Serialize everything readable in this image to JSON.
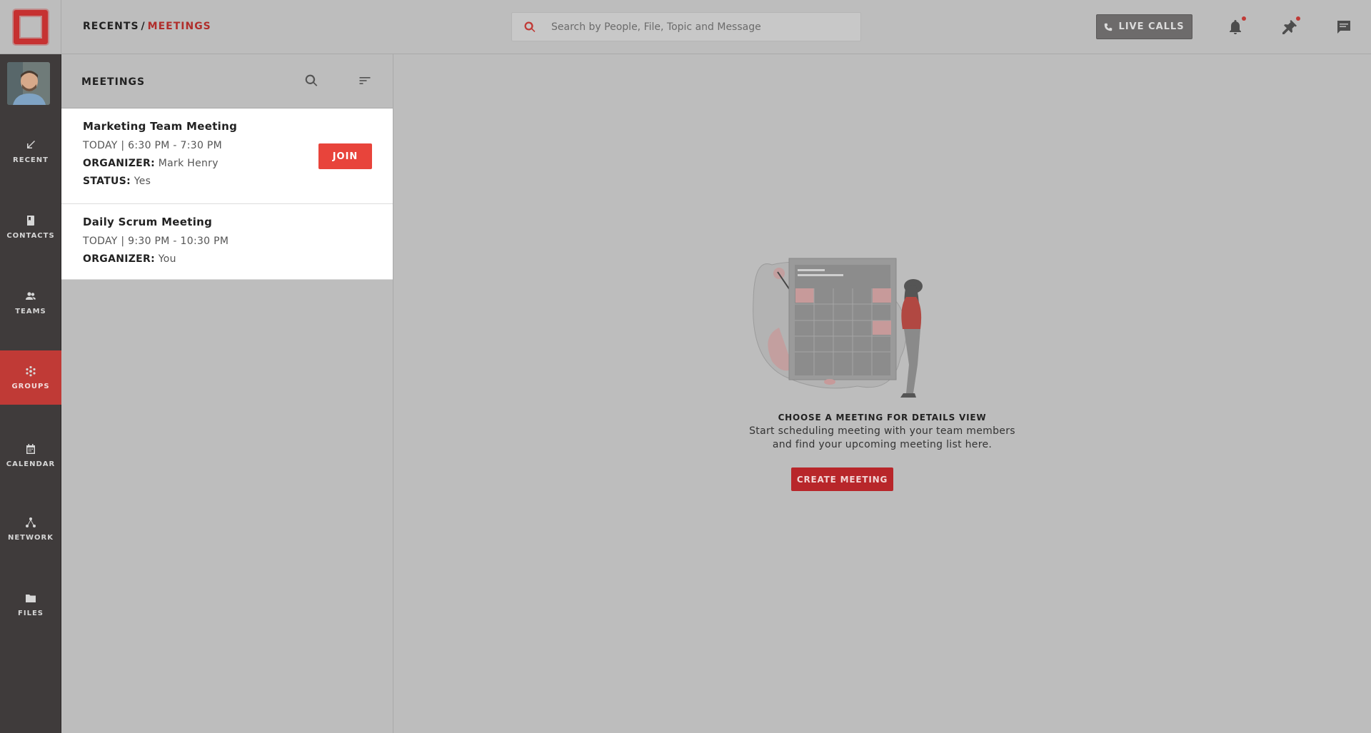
{
  "breadcrumb": {
    "root": "RECENTS",
    "separator": "/",
    "current": "MEETINGS"
  },
  "search": {
    "placeholder": "Search by People, File, Topic and Message"
  },
  "live_calls": {
    "label": "LIVE CALLS"
  },
  "nav": {
    "items": [
      {
        "label": "RECENT",
        "icon": "arrow-down-left-icon"
      },
      {
        "label": "CONTACTS",
        "icon": "contacts-book-icon"
      },
      {
        "label": "TEAMS",
        "icon": "team-icon"
      },
      {
        "label": "GROUPS",
        "icon": "groups-icon",
        "active": true
      },
      {
        "label": "CALENDAR",
        "icon": "calendar-icon"
      },
      {
        "label": "NETWORK",
        "icon": "network-icon"
      },
      {
        "label": "FILES",
        "icon": "folder-icon"
      }
    ]
  },
  "panel": {
    "title": "MEETINGS"
  },
  "meetings": [
    {
      "title": "Marketing Team Meeting",
      "time": "TODAY | 6:30 PM - 7:30 PM",
      "organizer_label": "ORGANIZER:",
      "organizer": "Mark Henry",
      "status_label": "STATUS:",
      "status": "Yes",
      "join_label": "JOIN"
    },
    {
      "title": "Daily Scrum Meeting",
      "time": "TODAY | 9:30 PM - 10:30 PM",
      "organizer_label": "ORGANIZER:",
      "organizer": "You"
    }
  ],
  "empty_state": {
    "title": "CHOOSE A MEETING FOR DETAILS VIEW",
    "line1": "Start scheduling meeting with your team members",
    "line2": "and find your upcoming meeting list here.",
    "button": "CREATE MEETING"
  },
  "colors": {
    "accent": "#c03a36",
    "nav_bg": "#3f3b3b",
    "join": "#e8443b",
    "create": "#b8262a"
  }
}
